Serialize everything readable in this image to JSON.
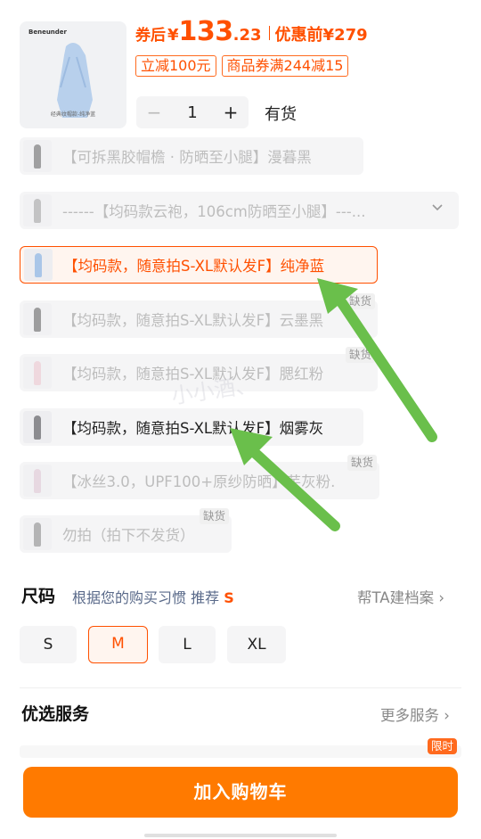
{
  "product": {
    "brand": "Beneunder",
    "thumb_caption": "经典纹帽款-纯净蓝"
  },
  "price": {
    "after_label": "券后",
    "currency": "¥",
    "integer": "133",
    "decimal": ".23",
    "before_label": "优惠前",
    "before_value": "¥279"
  },
  "coupons": [
    "立减100元",
    "商品券满244减15"
  ],
  "quantity": {
    "minus": "−",
    "value": "1",
    "plus": "+"
  },
  "stock_status": "有货",
  "options": [
    {
      "label": "【可拆黑胶帽檐 · 防晒至小腿】漫暮黑",
      "state": "disabled",
      "color": "#3a3a3a"
    },
    {
      "label": "------【均码款云袍，106cm防晒至小腿】---...",
      "state": "disabled",
      "color": "#888"
    },
    {
      "label": "【均码款，随意拍S-XL默认发F】纯净蓝",
      "state": "selected",
      "color": "#a9c6e8"
    },
    {
      "label": "【均码款，随意拍S-XL默认发F】云墨黑",
      "state": "disabled",
      "color": "#333"
    },
    {
      "label": "【均码款，随意拍S-XL默认发F】腮红粉",
      "state": "disabled",
      "color": "#e8b7c0"
    },
    {
      "label": "【均码款，随意拍S-XL默认发F】烟雾灰",
      "state": "normal",
      "color": "#8c8c90"
    },
    {
      "label": "【冰丝3.0，UPF100+原纱防晒】芋灰粉.",
      "state": "disabled",
      "color": "#d8b7c8"
    },
    {
      "label": "勿拍（拍下不发货）",
      "state": "disabled",
      "color": "#666"
    }
  ],
  "out_of_stock_label": "缺货",
  "size": {
    "title": "尺码",
    "hint": "根据您的购买习惯 推荐",
    "recommended": "S",
    "profile_link": "帮TA建档案",
    "chevron": "›",
    "options": [
      "S",
      "M",
      "L",
      "XL"
    ],
    "selected": "M"
  },
  "services": {
    "title": "优选服务",
    "more_link": "更多服务",
    "limited_tag": "限时"
  },
  "add_to_cart": "加入购物车",
  "watermark": "小小酒、",
  "colors": {
    "accent": "#ff5000",
    "button": "#ff7a00",
    "arrow": "#6abf4b"
  }
}
